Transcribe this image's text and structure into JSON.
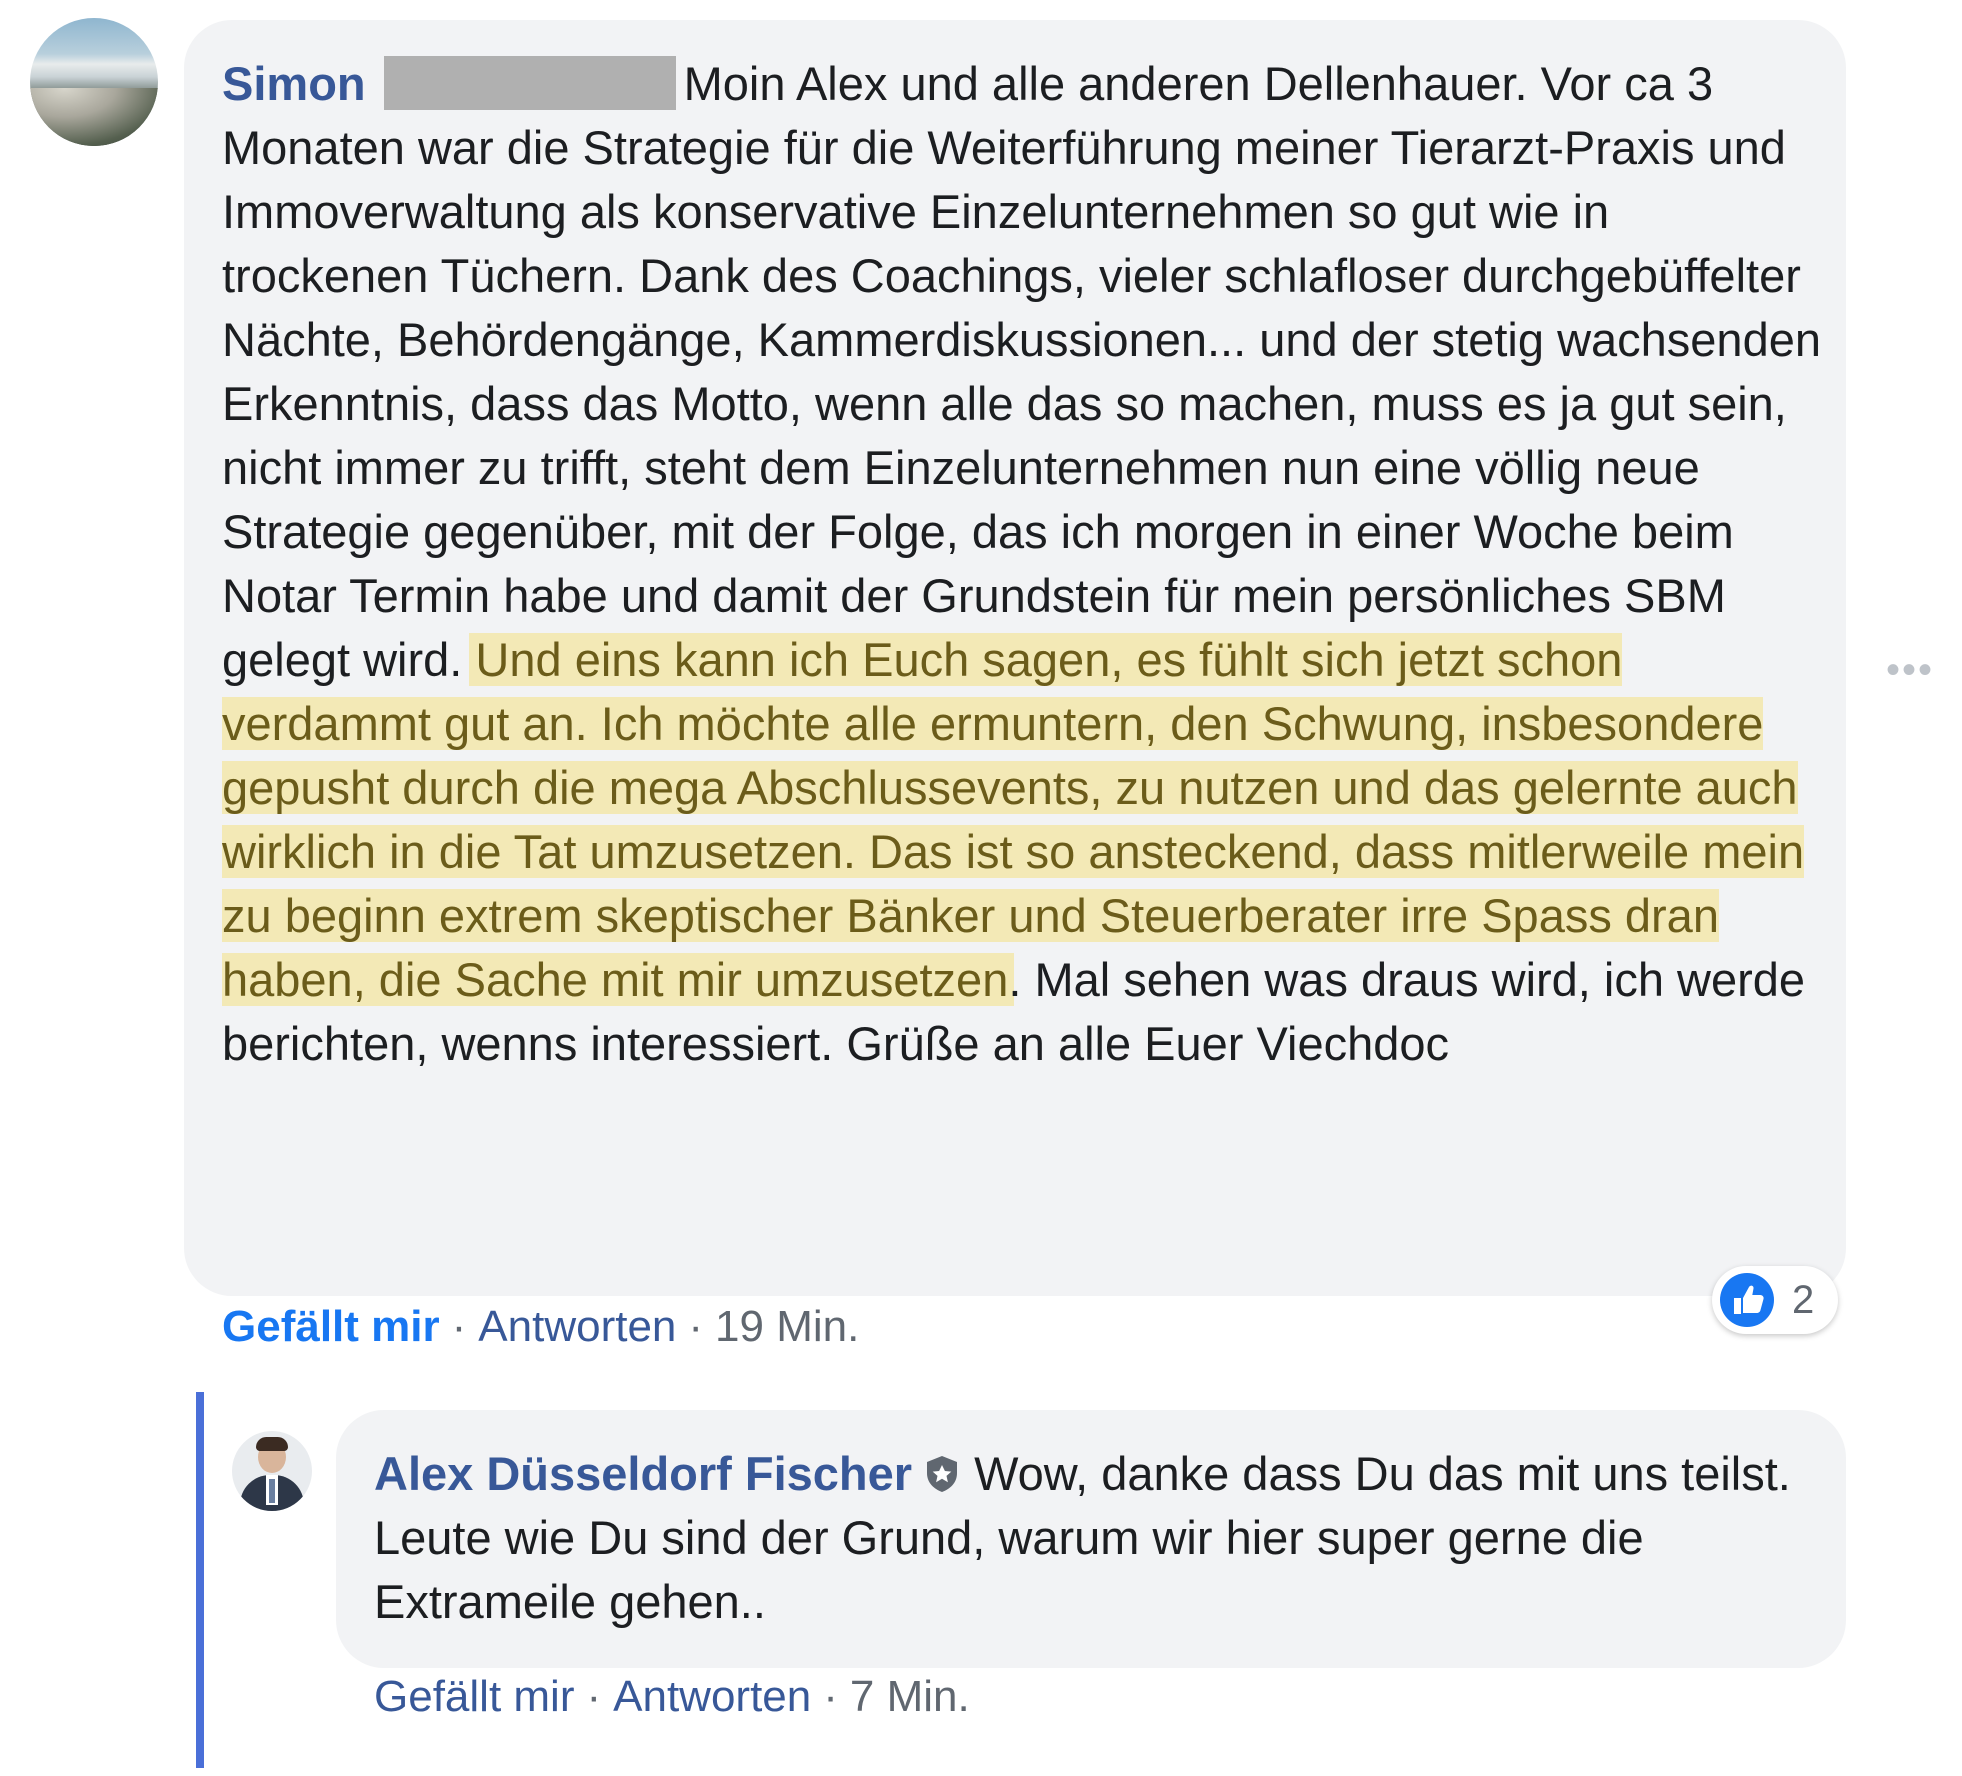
{
  "comments": [
    {
      "author": "Simon",
      "text_before_highlight": "Moin Alex und alle anderen Dellenhauer. Vor ca 3 Monaten war die Strategie für die Weiterführung meiner Tierarzt-Praxis und Immoverwaltung als konservative Einzelunternehmen so gut wie in trockenen Tüchern. Dank des Coachings, vieler schlafloser durchgebüffelter Nächte, Behördengänge, Kammerdiskussionen... und der stetig wachsenden Erkenntnis, dass das Motto, wenn alle das so machen, muss es ja gut sein, nicht immer zu trifft, steht dem Einzelunternehmen nun eine völlig neue Strategie gegenüber, mit der Folge, das ich morgen in einer Woche beim Notar Termin habe und damit der Grundstein für mein persönliches SBM gelegt wird.",
      "text_highlight": "Und eins kann ich Euch sagen, es fühlt sich jetzt schon verdammt gut an. Ich möchte alle ermuntern, den Schwung, insbesondere gepusht durch die mega Abschlussevents, zu nutzen und das gelernte auch wirklich in die Tat umzusetzen. Das ist so ansteckend, dass mitlerweile mein zu beginn extrem skeptischer Bänker und Steuerberater irre Spass dran haben, die Sache mit mir umzusetzen",
      "text_after_highlight": ". Mal sehen was draus wird, ich werde berichten, wenns interessiert. Grüße an alle Euer Viechdoc",
      "actions": {
        "like": "Gefällt mir",
        "reply": "Antworten",
        "time": "19 Min."
      },
      "reaction_count": "2",
      "reaction_icon": "thumbs-up-icon"
    },
    {
      "author": "Alex Düsseldorf Fischer",
      "author_badge_icon": "admin-shield-star-icon",
      "text": "Wow, danke dass Du das mit uns teilst. Leute wie Du sind der Grund, warum wir hier super gerne die Extrameile gehen..",
      "actions": {
        "like": "Gefällt mir",
        "reply": "Antworten",
        "time": "7 Min."
      }
    }
  ],
  "separator": "·",
  "more_options": "•••",
  "colors": {
    "link": "#385898",
    "like_active": "#1877f2",
    "bubble": "#f2f3f5",
    "highlight_bg": "#f3e9b6",
    "highlight_text": "#6b5c1a",
    "thread_line": "#4a6fd8"
  }
}
